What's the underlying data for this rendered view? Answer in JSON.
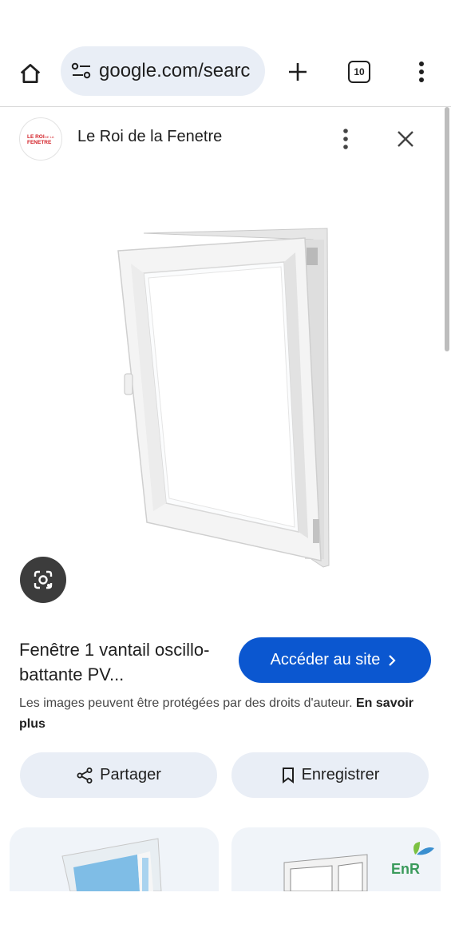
{
  "browser": {
    "url": "google.com/searc",
    "tab_count": "10"
  },
  "panel": {
    "site_name": "Le Roi de la Fenetre",
    "logo_text": "LE ROI DE LA FENETRE"
  },
  "result": {
    "title": "Fenêtre 1 vantail oscillo-battante PV...",
    "visit_button": "Accéder au site",
    "copyright_text": "Les images peuvent être protégées par des droits d'auteur.",
    "learn_more": "En savoir plus"
  },
  "actions": {
    "share": "Partager",
    "save": "Enregistrer"
  },
  "related": {
    "card2_badge": "EnR"
  },
  "colors": {
    "accent": "#0b57d0",
    "pill_bg": "#e9eef6",
    "logo_red": "#d32027"
  },
  "icons": [
    "home-icon",
    "tune-icon",
    "plus-icon",
    "tabs-icon",
    "more-vert-icon",
    "close-icon",
    "lens-icon",
    "share-icon",
    "bookmark-icon",
    "chevron-right-icon"
  ]
}
